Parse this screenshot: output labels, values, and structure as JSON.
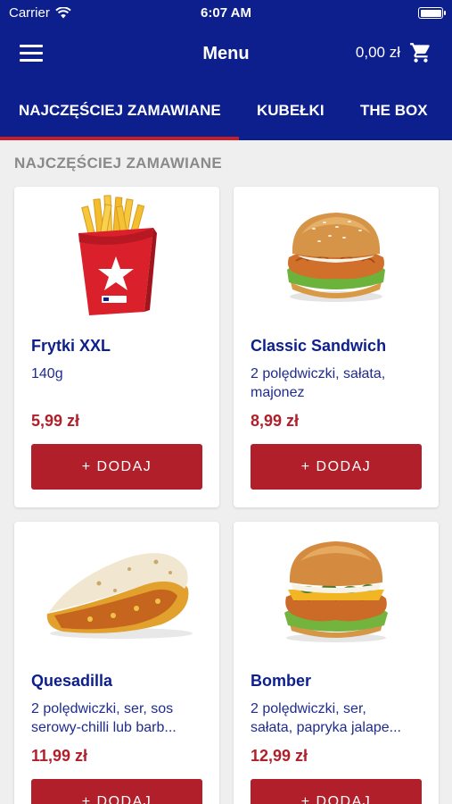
{
  "status_bar": {
    "carrier": "Carrier",
    "time": "6:07 AM",
    "icons": [
      "wifi-icon",
      "battery-icon"
    ]
  },
  "navbar": {
    "menu_icon": "hamburger-menu-icon",
    "title": "Menu",
    "cart_total": "0,00 zł",
    "cart_icon": "shopping-cart-icon"
  },
  "tabs": [
    {
      "label": "NAJCZĘŚCIEJ ZAMAWIANE",
      "active": true
    },
    {
      "label": "KUBEŁKI",
      "active": false
    },
    {
      "label": "THE BOX",
      "active": false
    }
  ],
  "section": {
    "title": "NAJCZĘŚCIEJ ZAMAWIANE"
  },
  "products": [
    {
      "name": "Frytki XXL",
      "desc_lines": [
        "140g"
      ],
      "price": "5,99 zł",
      "button": "+ DODAJ",
      "image": "fries-image"
    },
    {
      "name": "Classic Sandwich",
      "desc_lines": [
        "2 polędwiczki, sałata,",
        "majonez"
      ],
      "price": "8,99 zł",
      "button": "+ DODAJ",
      "image": "sandwich-image"
    },
    {
      "name": "Quesadilla",
      "desc_lines": [
        "2 polędwiczki, ser, sos",
        "serowy-chilli lub barb..."
      ],
      "price": "11,99 zł",
      "button": "+ DODAJ",
      "image": "quesadilla-image"
    },
    {
      "name": "Bomber",
      "desc_lines": [
        "2 polędwiczki, ser,",
        "sałata, papryka jalape..."
      ],
      "price": "12,99 zł",
      "button": "+ DODAJ",
      "image": "burger-image"
    }
  ],
  "colors": {
    "brand_blue": "#0d1f8c",
    "accent_red": "#b01f2a",
    "background": "#efefef"
  }
}
